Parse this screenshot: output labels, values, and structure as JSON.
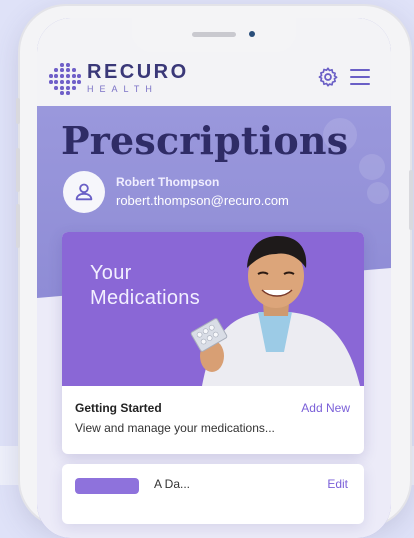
{
  "brand": {
    "name": "RECURO",
    "subname": "HEALTH"
  },
  "header": {
    "settings_icon": "gear-icon",
    "menu_icon": "hamburger-menu-icon"
  },
  "page": {
    "title": "Prescriptions"
  },
  "user": {
    "name": "Robert Thompson",
    "email": "robert.thompson@recuro.com",
    "avatar_icon": "user-icon"
  },
  "medication_card": {
    "image_title": "Your\nMedications",
    "footer_title": "Getting Started",
    "action_label": "Add New",
    "description": "View and manage your medications..."
  },
  "second_card": {
    "label": "A Da...",
    "action_label": "Edit"
  },
  "colors": {
    "accent": "#6f5fc8",
    "title": "#2f2c66",
    "link": "#7a5fd8"
  }
}
